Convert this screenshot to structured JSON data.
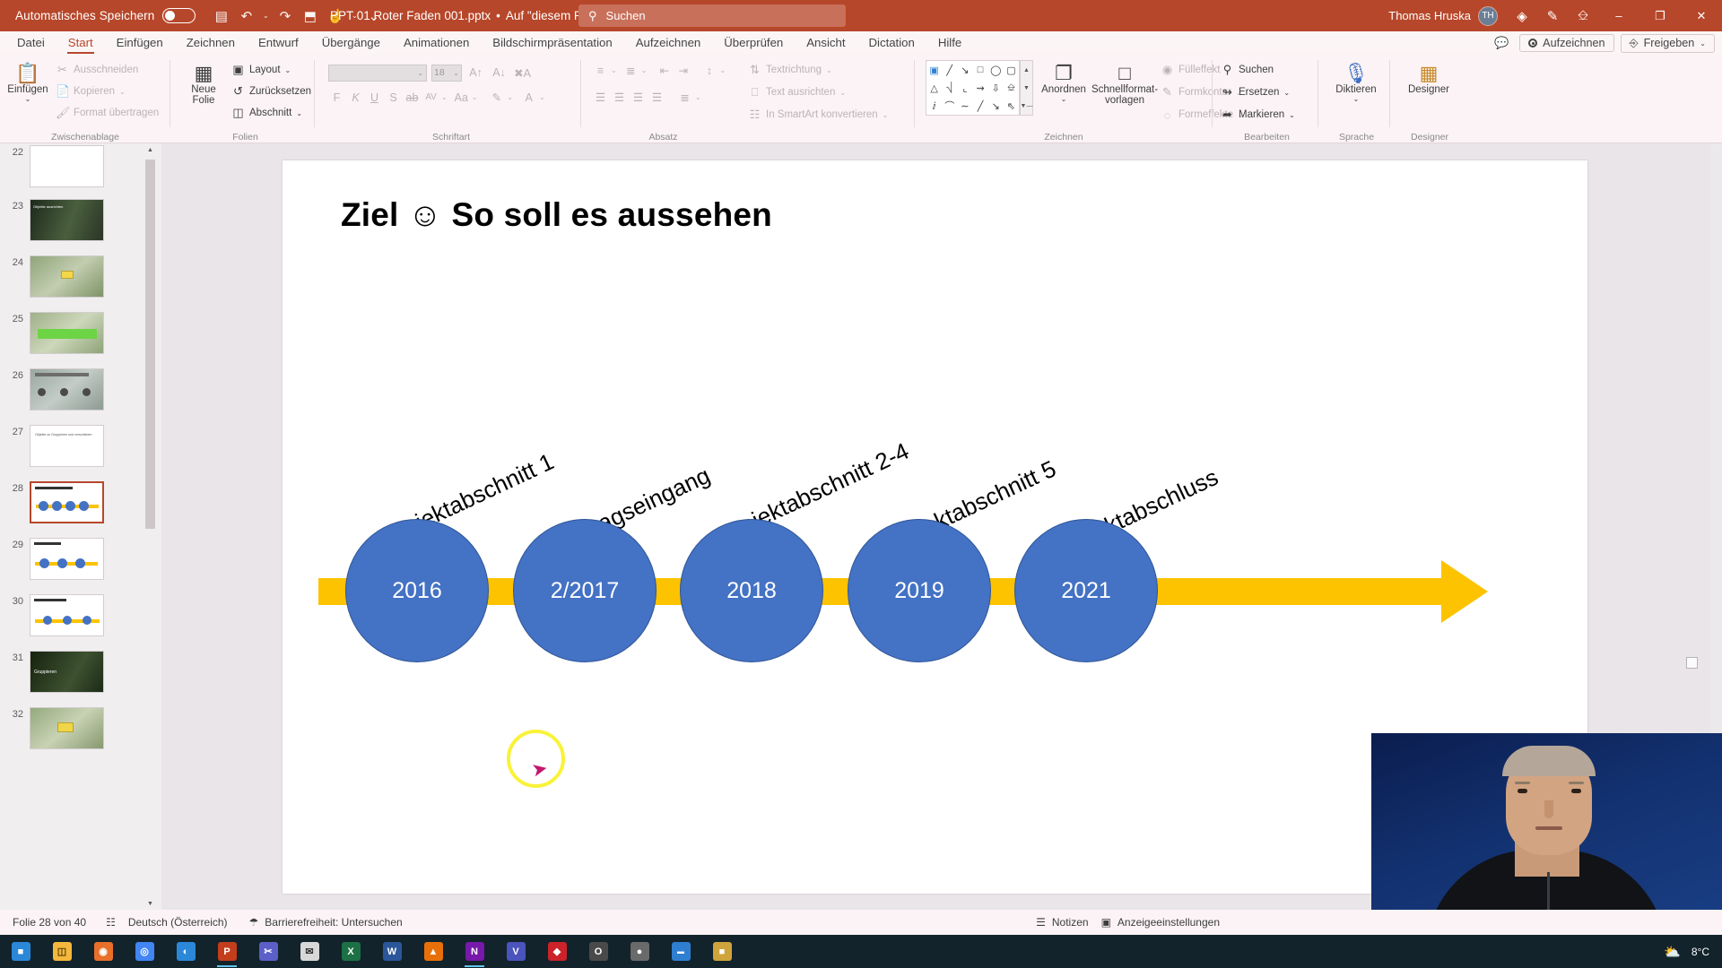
{
  "titlebar": {
    "autosave_label": "Automatisches Speichern",
    "document_name": "PPT 01 Roter Faden 001.pptx",
    "save_state": "Auf \"diesem PC\" gespeichert",
    "separator": "•",
    "search_placeholder": "Suchen",
    "user_name": "Thomas Hruska",
    "user_initials": "TH",
    "qat": [
      {
        "name": "save-icon",
        "glyph": "▤"
      },
      {
        "name": "undo-icon",
        "glyph": "↶"
      },
      {
        "name": "redo-icon",
        "glyph": "↷"
      },
      {
        "name": "start-slideshow-icon",
        "glyph": "⬒"
      },
      {
        "name": "touch-mode-icon",
        "glyph": "☝"
      },
      {
        "name": "customize-qat-icon",
        "glyph": "⌄"
      }
    ],
    "window_buttons": {
      "minimize": "–",
      "restore": "❐",
      "close": "✕"
    },
    "accent_color": "#b7472a"
  },
  "tabs": {
    "items": [
      {
        "label": "Datei",
        "active": false
      },
      {
        "label": "Start",
        "active": true
      },
      {
        "label": "Einfügen",
        "active": false
      },
      {
        "label": "Zeichnen",
        "active": false
      },
      {
        "label": "Entwurf",
        "active": false
      },
      {
        "label": "Übergänge",
        "active": false
      },
      {
        "label": "Animationen",
        "active": false
      },
      {
        "label": "Bildschirmpräsentation",
        "active": false
      },
      {
        "label": "Aufzeichnen",
        "active": false
      },
      {
        "label": "Überprüfen",
        "active": false
      },
      {
        "label": "Ansicht",
        "active": false
      },
      {
        "label": "Dictation",
        "active": false
      },
      {
        "label": "Hilfe",
        "active": false
      }
    ],
    "record_label": "Aufzeichnen",
    "share_label": "Freigeben"
  },
  "ribbon": {
    "groups": [
      {
        "name": "Zwischenablage"
      },
      {
        "name": "Folien"
      },
      {
        "name": "Schriftart"
      },
      {
        "name": "Absatz"
      },
      {
        "name": "Zeichnen"
      },
      {
        "name": "Bearbeiten"
      },
      {
        "name": "Sprache"
      },
      {
        "name": "Designer"
      }
    ],
    "clipboard": {
      "paste_label": "Einfügen",
      "cut_label": "Ausschneiden",
      "copy_label": "Kopieren",
      "format_painter_label": "Format übertragen"
    },
    "slides": {
      "new_slide_label": "Neue",
      "new_slide_label2": "Folie",
      "layout_label": "Layout",
      "reset_label": "Zurücksetzen",
      "section_label": "Abschnitt"
    },
    "font": {
      "font_name": "",
      "font_size": "18",
      "bold": "F",
      "italic": "K",
      "underline": "U",
      "shadow": "S",
      "strikethrough": "ab",
      "char_spacing": "AV",
      "change_case": "Aa"
    },
    "paragraph": {
      "text_direction_label": "Textrichtung",
      "align_text_label": "Text ausrichten",
      "smartart_label": "In SmartArt konvertieren"
    },
    "drawing": {
      "arrange_label": "Anordnen",
      "quickstyles_label": "Schnellformat-",
      "quickstyles_label2": "vorlagen",
      "fill_label": "Fülleffekt",
      "outline_label": "Formkontur",
      "effects_label": "Formeffekte"
    },
    "editing": {
      "find_label": "Suchen",
      "replace_label": "Ersetzen",
      "select_label": "Markieren"
    },
    "voice": {
      "dictate_label": "Diktieren"
    },
    "designer": {
      "designer_label": "Designer"
    }
  },
  "thumbnails": {
    "slides": [
      {
        "number": "22",
        "selected": false,
        "kind": "blank"
      },
      {
        "number": "23",
        "selected": false,
        "kind": "photo-dark",
        "caption": "Objekte ausrichten"
      },
      {
        "number": "24",
        "selected": false,
        "kind": "photo-trees"
      },
      {
        "number": "25",
        "selected": false,
        "kind": "photo-green"
      },
      {
        "number": "26",
        "selected": false,
        "kind": "photo-grey"
      },
      {
        "number": "27",
        "selected": false,
        "kind": "text",
        "caption": "Objekte zu Gruppieren und verschieben"
      },
      {
        "number": "28",
        "selected": true,
        "kind": "timeline"
      },
      {
        "number": "29",
        "selected": false,
        "kind": "timeline"
      },
      {
        "number": "30",
        "selected": false,
        "kind": "timeline"
      },
      {
        "number": "31",
        "selected": false,
        "kind": "photo-dark2",
        "caption": "Gruppieren"
      },
      {
        "number": "32",
        "selected": false,
        "kind": "photo-trees2"
      }
    ]
  },
  "slide": {
    "title": "Ziel ☺  So soll es aussehen",
    "timeline": {
      "bar_color": "#fdc300",
      "node_color": "#4472c4",
      "nodes": [
        {
          "value": "2016",
          "label": "Projektabschnitt 1"
        },
        {
          "value": "2/2017",
          "label": "Auftragseingang"
        },
        {
          "value": "2018",
          "label": "Projektabschnitt 2-4"
        },
        {
          "value": "2019",
          "label": "Projektabschnitt 5"
        },
        {
          "value": "2021",
          "label": "Projektabschluss"
        }
      ]
    }
  },
  "statusbar": {
    "slide_counter": "Folie 28 von 40",
    "language": "Deutsch (Österreich)",
    "accessibility": "Barrierefreiheit: Untersuchen",
    "notes_label": "Notizen",
    "display_settings_label": "Anzeigeeinstellungen"
  },
  "taskbar": {
    "items": [
      {
        "name": "start-button",
        "glyph": "⊞",
        "color": "#ffffff",
        "active": false
      },
      {
        "name": "file-explorer-icon",
        "glyph": "🗀",
        "color": "#f5b73c",
        "active": false
      },
      {
        "name": "firefox-icon",
        "glyph": "◉",
        "color": "#e8702a",
        "active": false
      },
      {
        "name": "chrome-icon",
        "glyph": "◎",
        "color": "#4285f4",
        "active": false
      },
      {
        "name": "edge-icon",
        "glyph": "◔",
        "color": "#2b88d8",
        "active": false
      },
      {
        "name": "powerpoint-icon",
        "glyph": "P",
        "color": "#c43e1c",
        "active": true
      },
      {
        "name": "snipping-tool-icon",
        "glyph": "✂",
        "color": "#5b5fc7",
        "active": false
      },
      {
        "name": "mail-icon",
        "glyph": "✉",
        "color": "#d8d8d8",
        "active": false
      },
      {
        "name": "excel-icon",
        "glyph": "X",
        "color": "#1d7044",
        "active": false
      },
      {
        "name": "word-icon",
        "glyph": "W",
        "color": "#2b579a",
        "active": false
      },
      {
        "name": "vlc-icon",
        "glyph": "▲",
        "color": "#e8700a",
        "active": false
      },
      {
        "name": "onenote-icon",
        "glyph": "N",
        "color": "#7719aa",
        "active": true
      },
      {
        "name": "teams-icon",
        "glyph": "V",
        "color": "#4b53bc",
        "active": false
      },
      {
        "name": "acrobat-icon",
        "glyph": "◆",
        "color": "#cc2229",
        "active": false
      },
      {
        "name": "opera-icon",
        "glyph": "O",
        "color": "#4a4a4a",
        "active": false
      },
      {
        "name": "record-icon",
        "glyph": "●",
        "color": "#6a6a6a",
        "active": false
      },
      {
        "name": "blue-app-icon",
        "glyph": "▬",
        "color": "#2f7fd1",
        "active": false
      },
      {
        "name": "folder2-icon",
        "glyph": "⬛",
        "color": "#cfa43c",
        "active": false
      }
    ],
    "weather_icon": "⛅",
    "weather_temp": "8°C"
  }
}
